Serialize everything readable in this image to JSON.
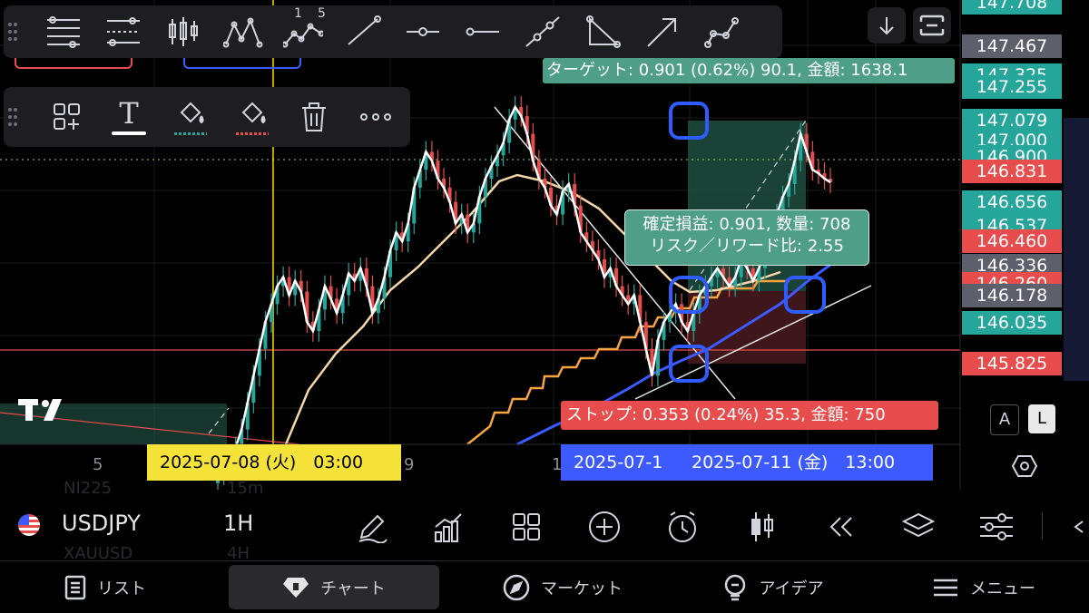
{
  "toolbar_top": {
    "icons": [
      "fib-retracement-icon",
      "fib-channel-icon",
      "candle-pattern-icon",
      "xabcd-pattern-icon",
      "elliott-wave-icon",
      "trend-line-icon",
      "horizontal-ray-icon",
      "horizontal-line-icon",
      "extended-line-icon",
      "triangle-icon",
      "arrow-icon",
      "path-icon"
    ],
    "elliott_labels": [
      "1",
      "5"
    ]
  },
  "toolbar_second": {
    "icons": [
      "add-widget-icon",
      "text-icon",
      "fill-color-icon",
      "line-color-icon",
      "trash-icon",
      "more-icon"
    ],
    "text_glyph": "T"
  },
  "right_buttons": {
    "scroll_down": "scroll-down-icon",
    "fullscreen": "fullscreen-icon"
  },
  "position_labels": {
    "target": "ターゲット: 0.901 (0.62%) 90.1, 金額: 1638.1",
    "pnl_line1": "確定損益: 0.901, 数量: 708",
    "pnl_line2": "リスク／リワード比: 2.55",
    "stop": "ストップ: 0.353 (0.24%) 35.3, 金額: 750"
  },
  "price_axis": {
    "labels": [
      {
        "text": "147.708",
        "color": "#26a69a"
      },
      {
        "text": "147.467",
        "color": "#5d606b"
      },
      {
        "text": "147.325",
        "color": "#26a69a"
      },
      {
        "text": "147.255",
        "color": "#26a69a"
      },
      {
        "text": "147.079",
        "color": "#26a69a"
      },
      {
        "text": "147.000",
        "color": "#26a69a"
      },
      {
        "text": "146.900",
        "color": "#26a69a"
      },
      {
        "text": "146.831",
        "color": "#e84d4d"
      },
      {
        "text": "146.656",
        "color": "#26a69a"
      },
      {
        "text": "146.537",
        "color": "#26a69a"
      },
      {
        "text": "146.460",
        "color": "#e84d4d"
      },
      {
        "text": "146.336",
        "color": "#5d606b"
      },
      {
        "text": "146.260",
        "color": "#e84d4d"
      },
      {
        "text": "146.178",
        "color": "#5d606b"
      },
      {
        "text": "146.035",
        "color": "#26a69a"
      },
      {
        "text": "145.825",
        "color": "#e84d4d"
      }
    ],
    "scale_a": "A",
    "scale_l": "L",
    "settings_icon": "hexagon-settings-icon"
  },
  "time_axis": {
    "ticks": [
      "5",
      "9",
      "1"
    ],
    "crosshair_date": "2025-07-08 (火)　03:00",
    "range_date_start": "2025-07-1",
    "range_date_end": "2025-07-11 (金)　13:00"
  },
  "logo": "TV",
  "symbol_bar": {
    "symbol": "USDJPY",
    "interval": "1H",
    "ghost_symbol_1": "NI225",
    "ghost_interval_1": "15m",
    "ghost_symbol_2": "XAUUSD",
    "ghost_interval_2": "4H",
    "tools": [
      "drawing-pen-icon",
      "indicators-icon",
      "templates-icon",
      "add-icon",
      "alert-clock-icon",
      "candles-icon",
      "replay-icon",
      "layers-icon",
      "settings-sliders-icon"
    ]
  },
  "bottom_nav": [
    {
      "label": "リスト",
      "icon": "list-icon"
    },
    {
      "label": "チャート",
      "icon": "chart-gem-icon",
      "active": true
    },
    {
      "label": "マーケット",
      "icon": "compass-icon"
    },
    {
      "label": "アイデア",
      "icon": "ideas-bulb-icon"
    },
    {
      "label": "メニュー",
      "icon": "menu-icon"
    }
  ],
  "colors": {
    "up": "#26a69a",
    "down": "#e84d4d",
    "target_zone": "#1f4d40",
    "stop_zone": "#4a1a1f",
    "ma_orange": "#f7a440",
    "ma_blue": "#3d5afe",
    "ma_beige": "#f5d6a8",
    "handle": "#2f5cff",
    "crosshair": "#f5d800",
    "range_bar": "#3d5afe"
  },
  "chart_data": {
    "type": "candlestick",
    "symbol": "USDJPY",
    "interval": "1H",
    "y_range": [
      145.6,
      147.8
    ],
    "closes": [
      145.2,
      145.25,
      145.3,
      145.35,
      145.45,
      145.6,
      145.75,
      145.9,
      146.05,
      146.15,
      146.25,
      146.3,
      146.2,
      146.28,
      146.22,
      146.05,
      146.0,
      146.12,
      146.25,
      146.18,
      146.1,
      146.2,
      146.32,
      146.28,
      146.35,
      146.25,
      146.1,
      146.18,
      146.3,
      146.45,
      146.55,
      146.5,
      146.6,
      146.8,
      146.9,
      147.0,
      146.95,
      146.85,
      146.8,
      146.72,
      146.6,
      146.65,
      146.55,
      146.6,
      146.75,
      146.85,
      146.92,
      146.98,
      147.05,
      147.18,
      147.25,
      147.2,
      147.1,
      146.95,
      146.85,
      146.8,
      146.7,
      146.65,
      146.78,
      146.82,
      146.7,
      146.55,
      146.5,
      146.45,
      146.4,
      146.3,
      146.35,
      146.25,
      146.2,
      146.15,
      146.2,
      146.05,
      145.9,
      145.75,
      145.95,
      146.05,
      146.1,
      146.15,
      146.05,
      146.0,
      146.1,
      146.2,
      146.25,
      146.3,
      146.35,
      146.3,
      146.25,
      146.3,
      146.4,
      146.35,
      146.28,
      146.35,
      146.45,
      146.55,
      146.65,
      146.75,
      146.82,
      146.95,
      147.1,
      147.0,
      146.9,
      146.88,
      146.85,
      146.83
    ]
  }
}
